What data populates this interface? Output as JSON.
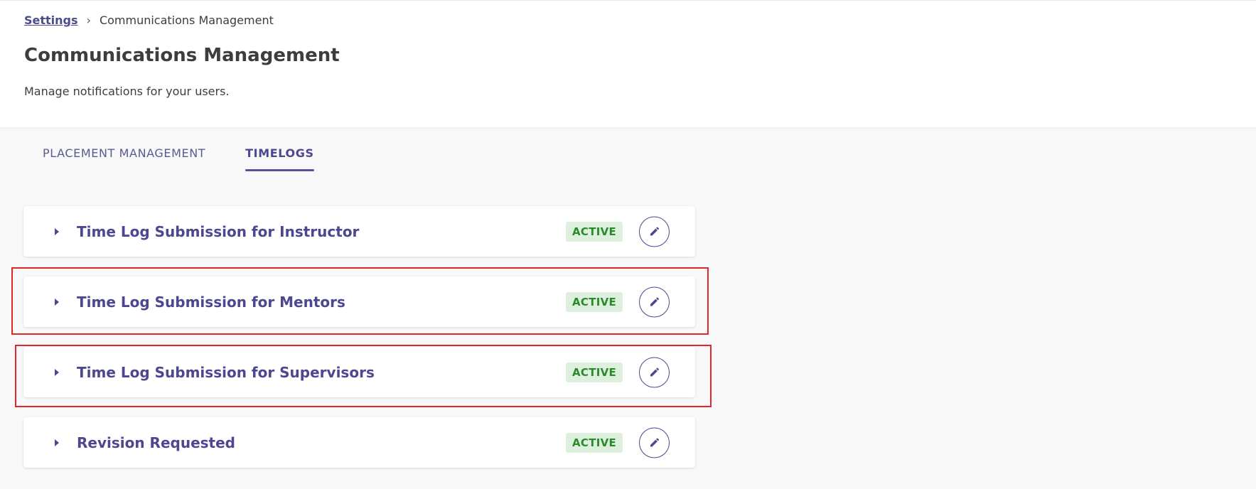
{
  "breadcrumb": {
    "parent": "Settings",
    "separator": "›",
    "current": "Communications Management"
  },
  "header": {
    "title": "Communications Management",
    "description": "Manage notifications for your users."
  },
  "tabs": [
    {
      "label": "PLACEMENT MANAGEMENT",
      "active": false
    },
    {
      "label": "TIMELOGS",
      "active": true
    }
  ],
  "notifications": [
    {
      "title": "Time Log Submission for Instructor",
      "status": "ACTIVE"
    },
    {
      "title": "Time Log Submission for Mentors",
      "status": "ACTIVE"
    },
    {
      "title": "Time Log Submission for Supervisors",
      "status": "ACTIVE"
    },
    {
      "title": "Revision Requested",
      "status": "ACTIVE"
    }
  ],
  "colors": {
    "accent": "#4d4690",
    "active_badge_bg": "#ddf0dd",
    "active_badge_text": "#2a8a2a",
    "highlight": "#e2262c"
  }
}
